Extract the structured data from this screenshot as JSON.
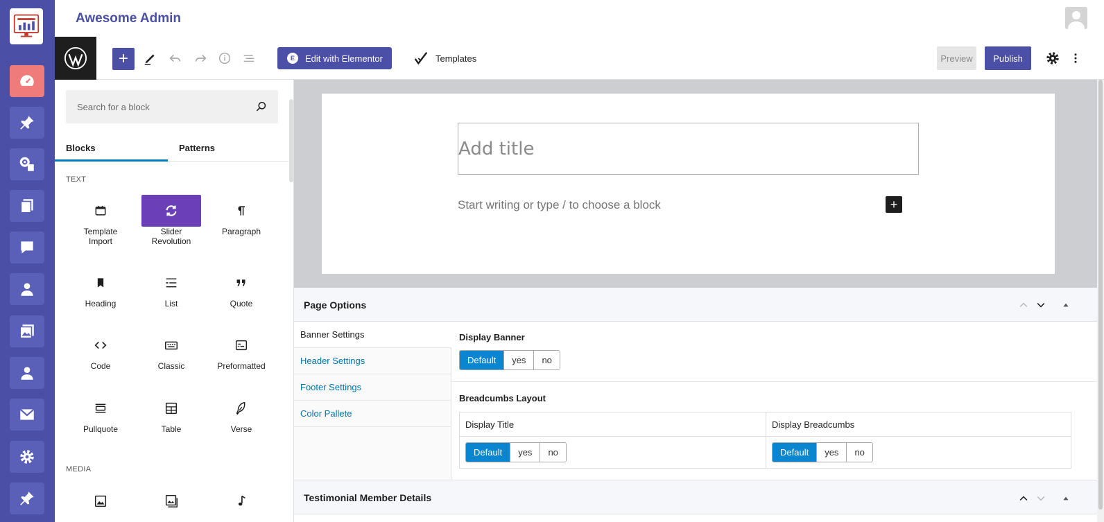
{
  "app": {
    "title": "Awesome Admin"
  },
  "rail": {
    "items": [
      "dashboard-icon",
      "pin-icon",
      "media-gear-icon",
      "pages-icon",
      "comments-icon",
      "user-icon",
      "gallery-icon",
      "profile-icon",
      "mail-icon",
      "settings-icon",
      "pin-icon"
    ],
    "accent": "#4b4fa6",
    "active_color": "#f07b7b"
  },
  "toolbar": {
    "elementor_label": "Edit with Elementor",
    "templates_label": "Templates",
    "preview_label": "Preview",
    "publish_label": "Publish"
  },
  "inserter": {
    "search_placeholder": "Search for a block",
    "tabs": [
      "Blocks",
      "Patterns"
    ],
    "categories": {
      "text": "TEXT",
      "media": "MEDIA"
    },
    "blocks": [
      {
        "label": "Template Import",
        "icon": "calendar-icon"
      },
      {
        "label": "Slider Revolution",
        "icon": "refresh-icon"
      },
      {
        "label": "Paragraph",
        "icon": "pilcrow-icon"
      },
      {
        "label": "Heading",
        "icon": "bookmark-icon"
      },
      {
        "label": "List",
        "icon": "list-icon"
      },
      {
        "label": "Quote",
        "icon": "quote-icon"
      },
      {
        "label": "Code",
        "icon": "code-icon"
      },
      {
        "label": "Classic",
        "icon": "keyboard-icon"
      },
      {
        "label": "Preformatted",
        "icon": "preformatted-icon"
      },
      {
        "label": "Pullquote",
        "icon": "pullquote-icon"
      },
      {
        "label": "Table",
        "icon": "table-icon"
      },
      {
        "label": "Verse",
        "icon": "feather-icon"
      }
    ]
  },
  "canvas": {
    "title_placeholder": "Add title",
    "body_placeholder": "Start writing or type / to choose a block"
  },
  "page_options": {
    "title": "Page Options",
    "side_tabs": [
      "Banner Settings",
      "Header Settings",
      "Footer Settings",
      "Color Pallete"
    ],
    "display_banner_label": "Display Banner",
    "breadcrumbs_label": "Breadcumbs Layout",
    "display_title_label": "Display Title",
    "display_breadcrumbs_label": "Display Breadcumbs",
    "options": [
      "Default",
      "yes",
      "no"
    ]
  },
  "testimonial": {
    "title": "Testimonial Member Details"
  }
}
